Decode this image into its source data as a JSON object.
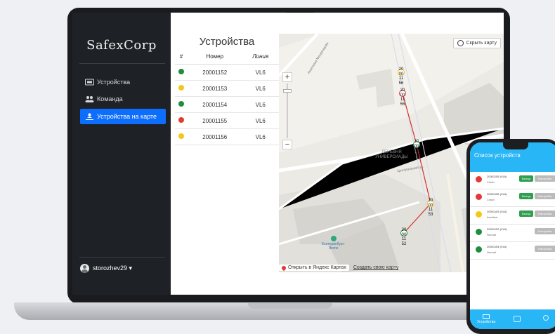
{
  "app": {
    "logo": "SafexCorp"
  },
  "sidebar": {
    "items": [
      {
        "label": "Устройства",
        "icon": "device-icon"
      },
      {
        "label": "Команда",
        "icon": "team-icon"
      },
      {
        "label": "Устройства на карте",
        "icon": "map-pin-person-icon"
      }
    ],
    "user": "storozhev29 ▾"
  },
  "devices": {
    "title": "Устройства",
    "columns": [
      "#",
      "Номер",
      "Линия"
    ],
    "rows": [
      {
        "id": "20001152",
        "line": "VL6",
        "color": "#1e8e3e"
      },
      {
        "id": "20001153",
        "line": "VL6",
        "color": "#f5c518"
      },
      {
        "id": "20001154",
        "line": "VL6",
        "color": "#1e8e3e"
      },
      {
        "id": "20001155",
        "line": "VL6",
        "color": "#e53935"
      },
      {
        "id": "20001156",
        "line": "VL6",
        "color": "#f5c518"
      }
    ]
  },
  "map": {
    "hide_map": "Скрыть карту",
    "open_yandex": "Открыть в Яндекс Картах",
    "create_map": "Создать свою карту",
    "zoom_in": "+",
    "zoom_out": "−",
    "district": "ДЕРЕВНЯ\nУНИВЕРСИАДЫ",
    "street1": "Центральная ул.",
    "street2": "Анатолия Мехренцева",
    "expo": "Екатеринбург-\nЭкспо",
    "markers": [
      {
        "label": "20\n00\n11\n56",
        "color": "#f5c518"
      },
      {
        "label": "20\n00\n11\n55",
        "color": "#e53935"
      },
      {
        "label": "20\n00\n11\n52",
        "color": "#1e8e3e"
      },
      {
        "label": "20\n00\n11\n53",
        "color": "#f5c518"
      },
      {
        "label": "20\n00\n11\n52",
        "color": "#1e8e3e"
      }
    ]
  },
  "phone": {
    "title": "Список устройств",
    "rows": [
      {
        "id": "20001155 (VL6)",
        "status": "Crash",
        "color": "#e53935",
        "exit": "Выход",
        "settings": "Настройки"
      },
      {
        "id": "20001156 (VL6)",
        "status": "Crash",
        "color": "#e53935",
        "exit": "Выход",
        "settings": "Настройки"
      },
      {
        "id": "20001153 (VL6)",
        "status": "Accident",
        "color": "#f5c518",
        "exit": "Выход",
        "settings": "Настройки"
      },
      {
        "id": "20001152 (VL6)",
        "status": "Normal",
        "color": "#1e8e3e",
        "exit": "",
        "settings": "Настройки"
      },
      {
        "id": "20001154 (VL6)",
        "status": "Normal",
        "color": "#1e8e3e",
        "exit": "",
        "settings": "Настройки"
      }
    ],
    "tab_devices": "Устройства"
  }
}
